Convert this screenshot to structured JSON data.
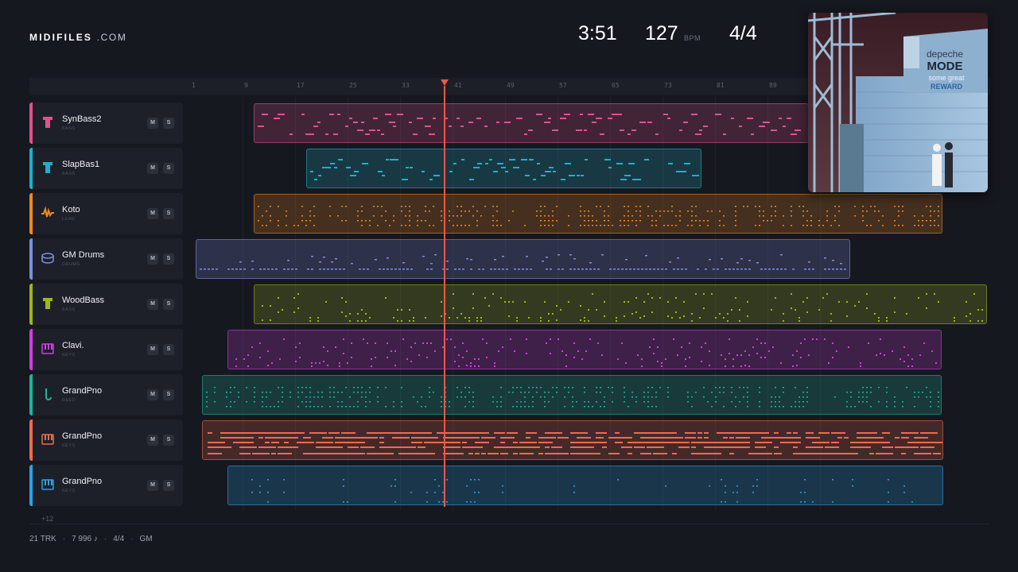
{
  "brand": {
    "name_bold": "MIDIFILES",
    "name_light": ".COM"
  },
  "transport": {
    "time": "3:51",
    "bpm": "127",
    "bpm_unit": "BPM",
    "time_signature": "4/4"
  },
  "ruler": {
    "bars": [
      "1",
      "9",
      "17",
      "25",
      "33",
      "41",
      "49",
      "57",
      "65",
      "73",
      "81",
      "89"
    ]
  },
  "playhead": {
    "bar": 37
  },
  "tracks": [
    {
      "name": "SynBass2",
      "category": "BASS",
      "color": "#e0528c",
      "icon": "bass-icon",
      "mute": "M",
      "solo": "S"
    },
    {
      "name": "SlapBas1",
      "category": "BASS",
      "color": "#1fb0c9",
      "icon": "bass-icon",
      "mute": "M",
      "solo": "S"
    },
    {
      "name": "Koto",
      "category": "LEAD",
      "color": "#ef8a1f",
      "icon": "waveform-icon",
      "mute": "M",
      "solo": "S"
    },
    {
      "name": "GM Drums",
      "category": "DRUMS",
      "color": "#7f8ee0",
      "icon": "drum-icon",
      "mute": "M",
      "solo": "S"
    },
    {
      "name": "WoodBass",
      "category": "BASS",
      "color": "#9fb51e",
      "icon": "bass-icon",
      "mute": "M",
      "solo": "S"
    },
    {
      "name": "Clavi.",
      "category": "KEYS",
      "color": "#d23ee0",
      "icon": "keys-icon",
      "mute": "M",
      "solo": "S"
    },
    {
      "name": "GrandPno",
      "category": "REED",
      "color": "#1fb59a",
      "icon": "reed-icon",
      "mute": "M",
      "solo": "S"
    },
    {
      "name": "GrandPno",
      "category": "KEYS",
      "color": "#ef6a4f",
      "icon": "keys-icon",
      "mute": "M",
      "solo": "S"
    },
    {
      "name": "GrandPno",
      "category": "KEYS",
      "color": "#2aa3e6",
      "icon": "keys-icon",
      "mute": "M",
      "solo": "S"
    }
  ],
  "more_tracks": "+12",
  "footer": {
    "tracks": "21 TRK",
    "notes": "7 996 ♪",
    "signature": "4/4",
    "standard": "GM"
  },
  "album": {
    "artist": "depeche",
    "artist2": "MODE",
    "title1": "some great",
    "title2": "REWARD"
  }
}
